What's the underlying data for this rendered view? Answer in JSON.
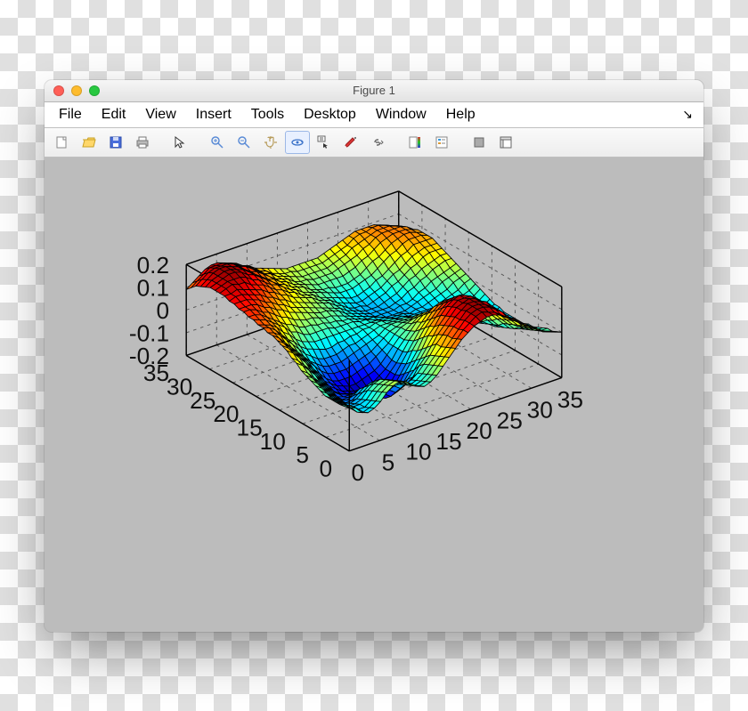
{
  "window": {
    "title": "Figure 1"
  },
  "menu": {
    "items": [
      "File",
      "Edit",
      "View",
      "Insert",
      "Tools",
      "Desktop",
      "Window",
      "Help"
    ],
    "dock_glyph": "↘"
  },
  "toolbar": {
    "new": "New Figure",
    "open": "Open",
    "save": "Save",
    "print": "Print",
    "pointer": "Edit Plot",
    "zoom_in": "Zoom In",
    "zoom_out": "Zoom Out",
    "pan": "Pan",
    "rotate": "Rotate 3D",
    "cursor": "Data Cursor",
    "brush": "Brush",
    "link": "Link",
    "colorbar": "Insert Colorbar",
    "legend": "Insert Legend",
    "hide": "Hide Plot Tools",
    "show": "Show Plot Tools"
  },
  "chart_data": {
    "type": "surface3d",
    "colormap": "jet",
    "x_axis": {
      "range": [
        0,
        35
      ],
      "ticks": [
        0,
        5,
        10,
        15,
        20,
        25,
        30,
        35
      ]
    },
    "y_axis": {
      "range": [
        0,
        35
      ],
      "ticks": [
        0,
        5,
        10,
        15,
        20,
        25,
        30,
        35
      ]
    },
    "z_axis": {
      "range": [
        -0.2,
        0.2
      ],
      "ticks": [
        -0.2,
        -0.1,
        0,
        0.1,
        0.2
      ]
    },
    "note": "35×35 surface; z-values estimated from colormap. Each row is a y index 0–34; each entry is an x index 0–34.",
    "z": [
      [
        0.0,
        -0.02,
        -0.05,
        -0.06,
        -0.05,
        -0.03,
        0.0,
        0.02,
        0.03,
        0.02,
        0.0,
        -0.02,
        -0.03,
        -0.02,
        0.0,
        0.03,
        0.06,
        0.09,
        0.12,
        0.14,
        0.16,
        0.17,
        0.18,
        0.18,
        0.17,
        0.15,
        0.13,
        0.11,
        0.09,
        0.07,
        0.05,
        0.03,
        0.02,
        0.01,
        0.0
      ],
      [
        -0.01,
        -0.03,
        -0.06,
        -0.07,
        -0.06,
        -0.04,
        -0.01,
        0.01,
        0.02,
        0.01,
        -0.01,
        -0.03,
        -0.04,
        -0.03,
        -0.01,
        0.02,
        0.05,
        0.08,
        0.11,
        0.14,
        0.16,
        0.18,
        0.19,
        0.18,
        0.17,
        0.15,
        0.13,
        0.11,
        0.09,
        0.07,
        0.05,
        0.03,
        0.01,
        0.0,
        -0.01
      ],
      [
        -0.02,
        -0.04,
        -0.06,
        -0.07,
        -0.07,
        -0.05,
        -0.02,
        0.0,
        0.01,
        0.0,
        -0.02,
        -0.04,
        -0.05,
        -0.04,
        -0.02,
        0.01,
        0.04,
        0.07,
        0.1,
        0.13,
        0.16,
        0.18,
        0.19,
        0.19,
        0.18,
        0.16,
        0.14,
        0.11,
        0.09,
        0.06,
        0.04,
        0.02,
        0.0,
        -0.01,
        -0.02
      ],
      [
        -0.02,
        -0.04,
        -0.06,
        -0.07,
        -0.07,
        -0.06,
        -0.03,
        -0.01,
        0.0,
        -0.01,
        -0.03,
        -0.05,
        -0.06,
        -0.05,
        -0.03,
        0.0,
        0.03,
        0.06,
        0.1,
        0.13,
        0.15,
        0.18,
        0.19,
        0.19,
        0.18,
        0.16,
        0.14,
        0.11,
        0.08,
        0.06,
        0.03,
        0.01,
        -0.01,
        -0.02,
        -0.02
      ],
      [
        -0.02,
        -0.04,
        -0.06,
        -0.08,
        -0.08,
        -0.07,
        -0.04,
        -0.02,
        -0.01,
        -0.02,
        -0.04,
        -0.06,
        -0.07,
        -0.06,
        -0.04,
        -0.01,
        0.02,
        0.06,
        0.09,
        0.12,
        0.15,
        0.17,
        0.19,
        0.19,
        0.18,
        0.17,
        0.14,
        0.11,
        0.08,
        0.05,
        0.02,
        0.0,
        -0.02,
        -0.03,
        -0.03
      ],
      [
        -0.02,
        -0.04,
        -0.06,
        -0.08,
        -0.09,
        -0.08,
        -0.06,
        -0.04,
        -0.03,
        -0.04,
        -0.06,
        -0.08,
        -0.1,
        -0.09,
        -0.07,
        -0.03,
        0.0,
        0.04,
        0.08,
        0.11,
        0.14,
        0.17,
        0.18,
        0.19,
        0.18,
        0.16,
        0.14,
        0.1,
        0.07,
        0.04,
        0.01,
        -0.01,
        -0.03,
        -0.04,
        -0.04
      ],
      [
        -0.01,
        -0.03,
        -0.06,
        -0.08,
        -0.1,
        -0.1,
        -0.08,
        -0.06,
        -0.05,
        -0.06,
        -0.08,
        -0.11,
        -0.13,
        -0.12,
        -0.09,
        -0.06,
        -0.02,
        0.02,
        0.06,
        0.1,
        0.13,
        0.16,
        0.18,
        0.18,
        0.18,
        0.16,
        0.13,
        0.1,
        0.06,
        0.03,
        0.0,
        -0.03,
        -0.04,
        -0.05,
        -0.05
      ],
      [
        0.0,
        -0.02,
        -0.05,
        -0.08,
        -0.1,
        -0.11,
        -0.1,
        -0.08,
        -0.08,
        -0.09,
        -0.11,
        -0.14,
        -0.16,
        -0.15,
        -0.12,
        -0.08,
        -0.04,
        0.0,
        0.05,
        0.08,
        0.12,
        0.15,
        0.17,
        0.18,
        0.17,
        0.15,
        0.12,
        0.09,
        0.05,
        0.02,
        -0.01,
        -0.04,
        -0.05,
        -0.06,
        -0.05
      ],
      [
        0.01,
        -0.01,
        -0.04,
        -0.07,
        -0.1,
        -0.12,
        -0.12,
        -0.11,
        -0.1,
        -0.11,
        -0.14,
        -0.17,
        -0.18,
        -0.17,
        -0.14,
        -0.1,
        -0.06,
        -0.02,
        0.03,
        0.07,
        0.1,
        0.13,
        0.15,
        0.16,
        0.16,
        0.14,
        0.11,
        0.07,
        0.04,
        0.0,
        -0.03,
        -0.05,
        -0.06,
        -0.06,
        -0.06
      ],
      [
        0.02,
        0.0,
        -0.03,
        -0.06,
        -0.09,
        -0.12,
        -0.13,
        -0.13,
        -0.13,
        -0.14,
        -0.16,
        -0.18,
        -0.19,
        -0.18,
        -0.16,
        -0.12,
        -0.08,
        -0.03,
        0.01,
        0.05,
        0.08,
        0.11,
        0.13,
        0.14,
        0.14,
        0.12,
        0.09,
        0.06,
        0.02,
        -0.01,
        -0.04,
        -0.06,
        -0.07,
        -0.07,
        -0.06
      ],
      [
        0.03,
        0.01,
        -0.02,
        -0.05,
        -0.08,
        -0.11,
        -0.13,
        -0.14,
        -0.15,
        -0.16,
        -0.17,
        -0.19,
        -0.19,
        -0.19,
        -0.17,
        -0.13,
        -0.09,
        -0.05,
        -0.01,
        0.03,
        0.06,
        0.09,
        0.11,
        0.12,
        0.12,
        0.1,
        0.07,
        0.04,
        0.01,
        -0.03,
        -0.05,
        -0.07,
        -0.07,
        -0.07,
        -0.06
      ],
      [
        0.05,
        0.03,
        0.0,
        -0.03,
        -0.07,
        -0.1,
        -0.13,
        -0.15,
        -0.16,
        -0.17,
        -0.18,
        -0.19,
        -0.19,
        -0.18,
        -0.16,
        -0.13,
        -0.1,
        -0.06,
        -0.02,
        0.01,
        0.04,
        0.07,
        0.09,
        0.1,
        0.09,
        0.08,
        0.05,
        0.02,
        -0.01,
        -0.04,
        -0.06,
        -0.07,
        -0.08,
        -0.07,
        -0.06
      ],
      [
        0.06,
        0.04,
        0.01,
        -0.02,
        -0.05,
        -0.09,
        -0.12,
        -0.14,
        -0.16,
        -0.17,
        -0.18,
        -0.18,
        -0.18,
        -0.17,
        -0.15,
        -0.13,
        -0.1,
        -0.06,
        -0.03,
        0.0,
        0.03,
        0.05,
        0.06,
        0.07,
        0.07,
        0.05,
        0.03,
        0.0,
        -0.03,
        -0.05,
        -0.07,
        -0.08,
        -0.08,
        -0.07,
        -0.06
      ],
      [
        0.08,
        0.06,
        0.03,
        0.0,
        -0.04,
        -0.07,
        -0.11,
        -0.13,
        -0.15,
        -0.16,
        -0.17,
        -0.17,
        -0.16,
        -0.15,
        -0.14,
        -0.12,
        -0.09,
        -0.06,
        -0.03,
        -0.01,
        0.01,
        0.03,
        0.04,
        0.04,
        0.04,
        0.03,
        0.01,
        -0.02,
        -0.04,
        -0.06,
        -0.08,
        -0.08,
        -0.08,
        -0.07,
        -0.05
      ],
      [
        0.09,
        0.07,
        0.04,
        0.01,
        -0.02,
        -0.06,
        -0.09,
        -0.12,
        -0.14,
        -0.15,
        -0.15,
        -0.15,
        -0.14,
        -0.13,
        -0.12,
        -0.1,
        -0.08,
        -0.06,
        -0.03,
        -0.01,
        0.0,
        0.01,
        0.02,
        0.02,
        0.02,
        0.0,
        -0.01,
        -0.03,
        -0.05,
        -0.07,
        -0.08,
        -0.08,
        -0.08,
        -0.06,
        -0.05
      ],
      [
        0.1,
        0.08,
        0.05,
        0.02,
        -0.01,
        -0.04,
        -0.07,
        -0.1,
        -0.12,
        -0.13,
        -0.13,
        -0.13,
        -0.12,
        -0.11,
        -0.1,
        -0.09,
        -0.07,
        -0.05,
        -0.03,
        -0.02,
        -0.01,
        -0.01,
        0.0,
        0.0,
        -0.01,
        -0.02,
        -0.03,
        -0.05,
        -0.06,
        -0.07,
        -0.08,
        -0.08,
        -0.07,
        -0.06,
        -0.04
      ],
      [
        0.11,
        0.09,
        0.06,
        0.03,
        0.0,
        -0.03,
        -0.06,
        -0.08,
        -0.1,
        -0.11,
        -0.11,
        -0.11,
        -0.1,
        -0.09,
        -0.08,
        -0.07,
        -0.06,
        -0.05,
        -0.03,
        -0.02,
        -0.02,
        -0.02,
        -0.02,
        -0.02,
        -0.03,
        -0.03,
        -0.04,
        -0.06,
        -0.07,
        -0.07,
        -0.08,
        -0.07,
        -0.06,
        -0.05,
        -0.03
      ],
      [
        0.11,
        0.1,
        0.08,
        0.05,
        0.02,
        -0.01,
        -0.04,
        -0.06,
        -0.08,
        -0.09,
        -0.09,
        -0.09,
        -0.08,
        -0.07,
        -0.07,
        -0.06,
        -0.05,
        -0.04,
        -0.03,
        -0.03,
        -0.03,
        -0.03,
        -0.03,
        -0.04,
        -0.04,
        -0.05,
        -0.06,
        -0.06,
        -0.07,
        -0.07,
        -0.07,
        -0.06,
        -0.05,
        -0.04,
        -0.02
      ],
      [
        0.12,
        0.11,
        0.09,
        0.06,
        0.03,
        0.01,
        -0.02,
        -0.04,
        -0.05,
        -0.06,
        -0.07,
        -0.07,
        -0.06,
        -0.06,
        -0.05,
        -0.05,
        -0.04,
        -0.04,
        -0.03,
        -0.03,
        -0.04,
        -0.04,
        -0.05,
        -0.05,
        -0.06,
        -0.06,
        -0.07,
        -0.07,
        -0.07,
        -0.07,
        -0.06,
        -0.05,
        -0.04,
        -0.03,
        -0.01
      ],
      [
        0.12,
        0.11,
        0.1,
        0.08,
        0.05,
        0.03,
        0.0,
        -0.02,
        -0.03,
        -0.04,
        -0.04,
        -0.04,
        -0.04,
        -0.04,
        -0.04,
        -0.04,
        -0.04,
        -0.04,
        -0.04,
        -0.04,
        -0.05,
        -0.05,
        -0.06,
        -0.06,
        -0.07,
        -0.07,
        -0.07,
        -0.07,
        -0.07,
        -0.06,
        -0.05,
        -0.04,
        -0.03,
        -0.01,
        0.0
      ],
      [
        0.13,
        0.12,
        0.11,
        0.09,
        0.07,
        0.05,
        0.02,
        0.01,
        -0.01,
        -0.02,
        -0.02,
        -0.02,
        -0.02,
        -0.03,
        -0.03,
        -0.03,
        -0.03,
        -0.04,
        -0.04,
        -0.05,
        -0.06,
        -0.06,
        -0.07,
        -0.07,
        -0.07,
        -0.08,
        -0.07,
        -0.07,
        -0.06,
        -0.05,
        -0.04,
        -0.03,
        -0.01,
        0.0,
        0.01
      ],
      [
        0.13,
        0.13,
        0.12,
        0.1,
        0.08,
        0.06,
        0.04,
        0.03,
        0.01,
        0.0,
        0.0,
        -0.01,
        -0.01,
        -0.02,
        -0.02,
        -0.03,
        -0.03,
        -0.04,
        -0.05,
        -0.06,
        -0.06,
        -0.07,
        -0.08,
        -0.08,
        -0.08,
        -0.08,
        -0.07,
        -0.06,
        -0.05,
        -0.04,
        -0.03,
        -0.01,
        0.0,
        0.01,
        0.02
      ],
      [
        0.14,
        0.14,
        0.13,
        0.11,
        0.1,
        0.08,
        0.06,
        0.05,
        0.03,
        0.02,
        0.01,
        0.01,
        0.0,
        -0.01,
        -0.01,
        -0.02,
        -0.03,
        -0.04,
        -0.05,
        -0.06,
        -0.07,
        -0.08,
        -0.08,
        -0.08,
        -0.08,
        -0.07,
        -0.07,
        -0.06,
        -0.04,
        -0.03,
        -0.01,
        0.0,
        0.01,
        0.02,
        0.03
      ],
      [
        0.14,
        0.14,
        0.14,
        0.13,
        0.11,
        0.1,
        0.08,
        0.07,
        0.05,
        0.04,
        0.03,
        0.02,
        0.01,
        0.0,
        0.0,
        -0.01,
        -0.02,
        -0.04,
        -0.05,
        -0.06,
        -0.07,
        -0.08,
        -0.08,
        -0.08,
        -0.08,
        -0.07,
        -0.06,
        -0.04,
        -0.03,
        -0.01,
        0.0,
        0.02,
        0.03,
        0.04,
        0.04
      ],
      [
        0.15,
        0.15,
        0.15,
        0.14,
        0.13,
        0.11,
        0.1,
        0.08,
        0.07,
        0.05,
        0.04,
        0.03,
        0.02,
        0.01,
        0.0,
        -0.01,
        -0.02,
        -0.03,
        -0.05,
        -0.06,
        -0.07,
        -0.08,
        -0.08,
        -0.08,
        -0.07,
        -0.06,
        -0.05,
        -0.03,
        -0.01,
        0.0,
        0.02,
        0.03,
        0.04,
        0.05,
        0.05
      ],
      [
        0.15,
        0.16,
        0.16,
        0.15,
        0.14,
        0.13,
        0.11,
        0.1,
        0.08,
        0.07,
        0.05,
        0.04,
        0.03,
        0.02,
        0.01,
        0.0,
        -0.01,
        -0.03,
        -0.04,
        -0.06,
        -0.07,
        -0.07,
        -0.08,
        -0.07,
        -0.06,
        -0.05,
        -0.03,
        -0.02,
        0.0,
        0.02,
        0.03,
        0.05,
        0.06,
        0.06,
        0.06
      ],
      [
        0.16,
        0.16,
        0.17,
        0.16,
        0.15,
        0.14,
        0.13,
        0.11,
        0.1,
        0.08,
        0.07,
        0.05,
        0.04,
        0.03,
        0.02,
        0.0,
        -0.01,
        -0.02,
        -0.04,
        -0.05,
        -0.06,
        -0.07,
        -0.07,
        -0.06,
        -0.05,
        -0.04,
        -0.02,
        0.0,
        0.01,
        0.03,
        0.05,
        0.06,
        0.07,
        0.07,
        0.07
      ],
      [
        0.16,
        0.17,
        0.18,
        0.17,
        0.17,
        0.15,
        0.14,
        0.13,
        0.11,
        0.09,
        0.08,
        0.06,
        0.05,
        0.03,
        0.02,
        0.01,
        -0.01,
        -0.02,
        -0.03,
        -0.04,
        -0.05,
        -0.06,
        -0.06,
        -0.05,
        -0.04,
        -0.02,
        -0.01,
        0.01,
        0.03,
        0.05,
        0.06,
        0.08,
        0.08,
        0.08,
        0.08
      ],
      [
        0.16,
        0.17,
        0.18,
        0.18,
        0.18,
        0.17,
        0.15,
        0.14,
        0.12,
        0.1,
        0.09,
        0.07,
        0.05,
        0.04,
        0.02,
        0.01,
        0.0,
        -0.01,
        -0.02,
        -0.03,
        -0.04,
        -0.04,
        -0.04,
        -0.03,
        -0.02,
        -0.01,
        0.01,
        0.03,
        0.05,
        0.06,
        0.08,
        0.09,
        0.09,
        0.09,
        0.08
      ],
      [
        0.16,
        0.17,
        0.18,
        0.19,
        0.19,
        0.18,
        0.16,
        0.15,
        0.13,
        0.11,
        0.09,
        0.07,
        0.06,
        0.04,
        0.03,
        0.02,
        0.0,
        -0.01,
        -0.02,
        -0.02,
        -0.03,
        -0.03,
        -0.03,
        -0.02,
        -0.01,
        0.01,
        0.03,
        0.04,
        0.06,
        0.08,
        0.09,
        0.1,
        0.1,
        0.09,
        0.08
      ],
      [
        0.15,
        0.17,
        0.18,
        0.19,
        0.19,
        0.18,
        0.17,
        0.15,
        0.13,
        0.11,
        0.09,
        0.08,
        0.06,
        0.05,
        0.03,
        0.02,
        0.01,
        0.0,
        -0.01,
        -0.01,
        -0.01,
        -0.01,
        -0.01,
        0.0,
        0.01,
        0.03,
        0.04,
        0.06,
        0.08,
        0.09,
        0.1,
        0.1,
        0.1,
        0.09,
        0.08
      ],
      [
        0.14,
        0.16,
        0.18,
        0.19,
        0.19,
        0.18,
        0.17,
        0.15,
        0.13,
        0.12,
        0.1,
        0.08,
        0.06,
        0.05,
        0.04,
        0.02,
        0.01,
        0.01,
        0.0,
        0.0,
        0.0,
        0.0,
        0.01,
        0.02,
        0.03,
        0.04,
        0.06,
        0.07,
        0.09,
        0.1,
        0.1,
        0.1,
        0.1,
        0.09,
        0.07
      ],
      [
        0.13,
        0.15,
        0.17,
        0.18,
        0.18,
        0.18,
        0.17,
        0.15,
        0.14,
        0.12,
        0.1,
        0.08,
        0.07,
        0.05,
        0.04,
        0.03,
        0.02,
        0.01,
        0.01,
        0.01,
        0.01,
        0.01,
        0.02,
        0.03,
        0.04,
        0.06,
        0.07,
        0.08,
        0.09,
        0.1,
        0.1,
        0.1,
        0.09,
        0.08,
        0.06
      ],
      [
        0.11,
        0.13,
        0.15,
        0.17,
        0.17,
        0.17,
        0.16,
        0.15,
        0.13,
        0.12,
        0.1,
        0.08,
        0.07,
        0.05,
        0.04,
        0.03,
        0.03,
        0.02,
        0.02,
        0.02,
        0.02,
        0.02,
        0.03,
        0.04,
        0.05,
        0.06,
        0.08,
        0.09,
        0.09,
        0.1,
        0.1,
        0.09,
        0.08,
        0.07,
        0.05
      ],
      [
        0.09,
        0.11,
        0.13,
        0.15,
        0.16,
        0.16,
        0.15,
        0.14,
        0.13,
        0.11,
        0.1,
        0.08,
        0.07,
        0.06,
        0.05,
        0.04,
        0.03,
        0.03,
        0.03,
        0.03,
        0.03,
        0.03,
        0.04,
        0.05,
        0.06,
        0.07,
        0.08,
        0.09,
        0.09,
        0.09,
        0.09,
        0.08,
        0.07,
        0.05,
        0.04
      ]
    ]
  }
}
